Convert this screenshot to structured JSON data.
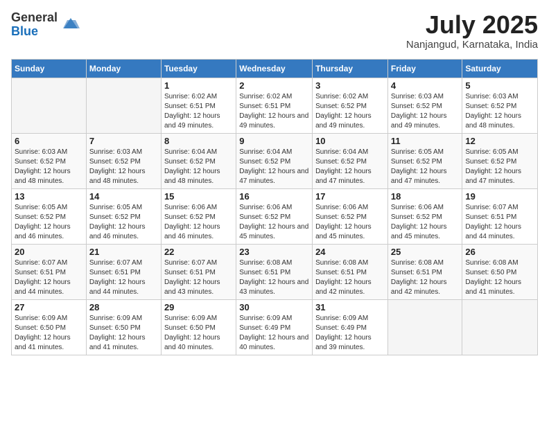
{
  "header": {
    "logo_general": "General",
    "logo_blue": "Blue",
    "month": "July 2025",
    "location": "Nanjangud, Karnataka, India"
  },
  "days_of_week": [
    "Sunday",
    "Monday",
    "Tuesday",
    "Wednesday",
    "Thursday",
    "Friday",
    "Saturday"
  ],
  "weeks": [
    [
      {
        "day": "",
        "sunrise": "",
        "sunset": "",
        "daylight": "",
        "empty": true
      },
      {
        "day": "",
        "sunrise": "",
        "sunset": "",
        "daylight": "",
        "empty": true
      },
      {
        "day": "1",
        "sunrise": "Sunrise: 6:02 AM",
        "sunset": "Sunset: 6:51 PM",
        "daylight": "Daylight: 12 hours and 49 minutes."
      },
      {
        "day": "2",
        "sunrise": "Sunrise: 6:02 AM",
        "sunset": "Sunset: 6:51 PM",
        "daylight": "Daylight: 12 hours and 49 minutes."
      },
      {
        "day": "3",
        "sunrise": "Sunrise: 6:02 AM",
        "sunset": "Sunset: 6:52 PM",
        "daylight": "Daylight: 12 hours and 49 minutes."
      },
      {
        "day": "4",
        "sunrise": "Sunrise: 6:03 AM",
        "sunset": "Sunset: 6:52 PM",
        "daylight": "Daylight: 12 hours and 49 minutes."
      },
      {
        "day": "5",
        "sunrise": "Sunrise: 6:03 AM",
        "sunset": "Sunset: 6:52 PM",
        "daylight": "Daylight: 12 hours and 48 minutes."
      }
    ],
    [
      {
        "day": "6",
        "sunrise": "Sunrise: 6:03 AM",
        "sunset": "Sunset: 6:52 PM",
        "daylight": "Daylight: 12 hours and 48 minutes."
      },
      {
        "day": "7",
        "sunrise": "Sunrise: 6:03 AM",
        "sunset": "Sunset: 6:52 PM",
        "daylight": "Daylight: 12 hours and 48 minutes."
      },
      {
        "day": "8",
        "sunrise": "Sunrise: 6:04 AM",
        "sunset": "Sunset: 6:52 PM",
        "daylight": "Daylight: 12 hours and 48 minutes."
      },
      {
        "day": "9",
        "sunrise": "Sunrise: 6:04 AM",
        "sunset": "Sunset: 6:52 PM",
        "daylight": "Daylight: 12 hours and 47 minutes."
      },
      {
        "day": "10",
        "sunrise": "Sunrise: 6:04 AM",
        "sunset": "Sunset: 6:52 PM",
        "daylight": "Daylight: 12 hours and 47 minutes."
      },
      {
        "day": "11",
        "sunrise": "Sunrise: 6:05 AM",
        "sunset": "Sunset: 6:52 PM",
        "daylight": "Daylight: 12 hours and 47 minutes."
      },
      {
        "day": "12",
        "sunrise": "Sunrise: 6:05 AM",
        "sunset": "Sunset: 6:52 PM",
        "daylight": "Daylight: 12 hours and 47 minutes."
      }
    ],
    [
      {
        "day": "13",
        "sunrise": "Sunrise: 6:05 AM",
        "sunset": "Sunset: 6:52 PM",
        "daylight": "Daylight: 12 hours and 46 minutes."
      },
      {
        "day": "14",
        "sunrise": "Sunrise: 6:05 AM",
        "sunset": "Sunset: 6:52 PM",
        "daylight": "Daylight: 12 hours and 46 minutes."
      },
      {
        "day": "15",
        "sunrise": "Sunrise: 6:06 AM",
        "sunset": "Sunset: 6:52 PM",
        "daylight": "Daylight: 12 hours and 46 minutes."
      },
      {
        "day": "16",
        "sunrise": "Sunrise: 6:06 AM",
        "sunset": "Sunset: 6:52 PM",
        "daylight": "Daylight: 12 hours and 45 minutes."
      },
      {
        "day": "17",
        "sunrise": "Sunrise: 6:06 AM",
        "sunset": "Sunset: 6:52 PM",
        "daylight": "Daylight: 12 hours and 45 minutes."
      },
      {
        "day": "18",
        "sunrise": "Sunrise: 6:06 AM",
        "sunset": "Sunset: 6:52 PM",
        "daylight": "Daylight: 12 hours and 45 minutes."
      },
      {
        "day": "19",
        "sunrise": "Sunrise: 6:07 AM",
        "sunset": "Sunset: 6:51 PM",
        "daylight": "Daylight: 12 hours and 44 minutes."
      }
    ],
    [
      {
        "day": "20",
        "sunrise": "Sunrise: 6:07 AM",
        "sunset": "Sunset: 6:51 PM",
        "daylight": "Daylight: 12 hours and 44 minutes."
      },
      {
        "day": "21",
        "sunrise": "Sunrise: 6:07 AM",
        "sunset": "Sunset: 6:51 PM",
        "daylight": "Daylight: 12 hours and 44 minutes."
      },
      {
        "day": "22",
        "sunrise": "Sunrise: 6:07 AM",
        "sunset": "Sunset: 6:51 PM",
        "daylight": "Daylight: 12 hours and 43 minutes."
      },
      {
        "day": "23",
        "sunrise": "Sunrise: 6:08 AM",
        "sunset": "Sunset: 6:51 PM",
        "daylight": "Daylight: 12 hours and 43 minutes."
      },
      {
        "day": "24",
        "sunrise": "Sunrise: 6:08 AM",
        "sunset": "Sunset: 6:51 PM",
        "daylight": "Daylight: 12 hours and 42 minutes."
      },
      {
        "day": "25",
        "sunrise": "Sunrise: 6:08 AM",
        "sunset": "Sunset: 6:51 PM",
        "daylight": "Daylight: 12 hours and 42 minutes."
      },
      {
        "day": "26",
        "sunrise": "Sunrise: 6:08 AM",
        "sunset": "Sunset: 6:50 PM",
        "daylight": "Daylight: 12 hours and 41 minutes."
      }
    ],
    [
      {
        "day": "27",
        "sunrise": "Sunrise: 6:09 AM",
        "sunset": "Sunset: 6:50 PM",
        "daylight": "Daylight: 12 hours and 41 minutes."
      },
      {
        "day": "28",
        "sunrise": "Sunrise: 6:09 AM",
        "sunset": "Sunset: 6:50 PM",
        "daylight": "Daylight: 12 hours and 41 minutes."
      },
      {
        "day": "29",
        "sunrise": "Sunrise: 6:09 AM",
        "sunset": "Sunset: 6:50 PM",
        "daylight": "Daylight: 12 hours and 40 minutes."
      },
      {
        "day": "30",
        "sunrise": "Sunrise: 6:09 AM",
        "sunset": "Sunset: 6:49 PM",
        "daylight": "Daylight: 12 hours and 40 minutes."
      },
      {
        "day": "31",
        "sunrise": "Sunrise: 6:09 AM",
        "sunset": "Sunset: 6:49 PM",
        "daylight": "Daylight: 12 hours and 39 minutes."
      },
      {
        "day": "",
        "sunrise": "",
        "sunset": "",
        "daylight": "",
        "empty": true
      },
      {
        "day": "",
        "sunrise": "",
        "sunset": "",
        "daylight": "",
        "empty": true
      }
    ]
  ]
}
